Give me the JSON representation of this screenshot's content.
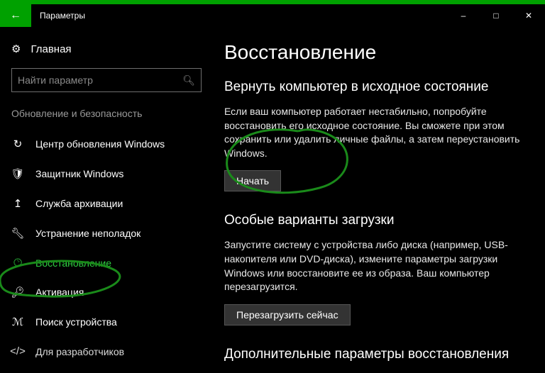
{
  "titlebar": {
    "title": "Параметры"
  },
  "sidebar": {
    "home": "Главная",
    "search_placeholder": "Найти параметр",
    "category": "Обновление и безопасность",
    "items": [
      {
        "label": "Центр обновления Windows"
      },
      {
        "label": "Защитник Windows"
      },
      {
        "label": "Служба архивации"
      },
      {
        "label": "Устранение неполадок"
      },
      {
        "label": "Восстановление"
      },
      {
        "label": "Активация"
      },
      {
        "label": "Поиск устройства"
      },
      {
        "label": "Для разработчиков"
      }
    ]
  },
  "main": {
    "h1": "Восстановление",
    "reset": {
      "h2": "Вернуть компьютер в исходное состояние",
      "body": "Если ваш компьютер работает нестабильно, попробуйте восстановить его исходное состояние. Вы сможете при этом сохранить или удалить личные файлы, а затем переустановить Windows.",
      "button": "Начать"
    },
    "advanced": {
      "h2": "Особые варианты загрузки",
      "body": "Запустите систему с устройства либо диска (например, USB-накопителя или DVD-диска), измените параметры загрузки Windows или восстановите ее из образа. Ваш компьютер перезагрузится.",
      "button": "Перезагрузить сейчас"
    },
    "more": {
      "h2": "Дополнительные параметры восстановления"
    }
  }
}
